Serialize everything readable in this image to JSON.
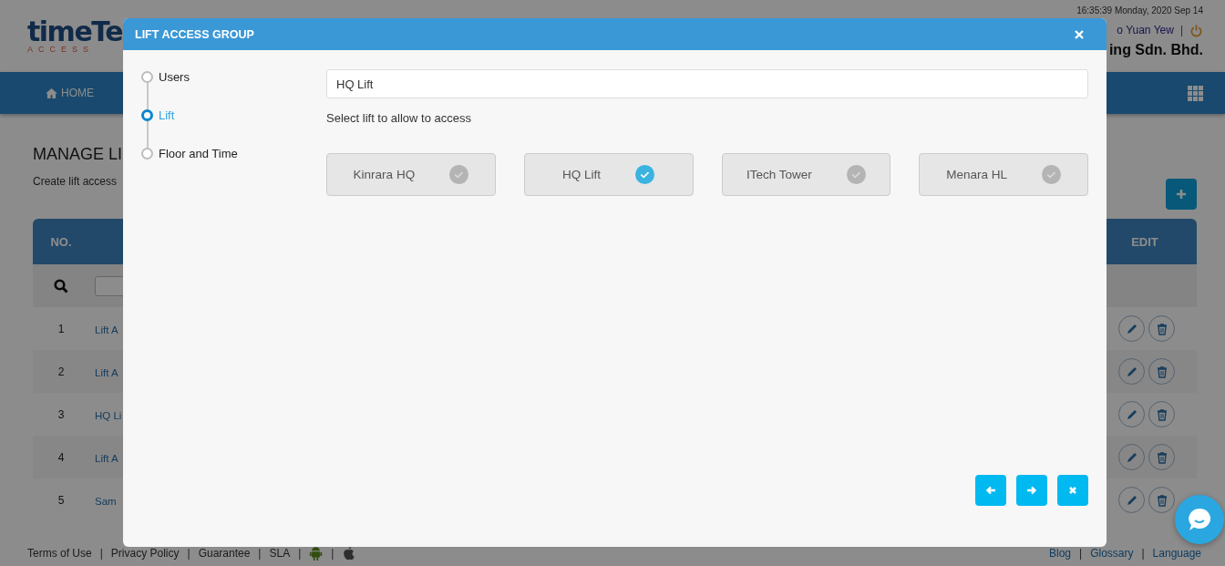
{
  "header": {
    "logo": {
      "text": "timeTe",
      "subtext": "ACCESS"
    },
    "datetime": "16:35:39 Monday, 2020 Sep 14",
    "user": "o Yuan Yew",
    "separator": "|",
    "company": "ing Sdn. Bhd."
  },
  "nav": {
    "items": [
      {
        "label": "HOME"
      }
    ]
  },
  "page": {
    "title": "MANAGE LI",
    "subtitle": "Create lift access"
  },
  "table": {
    "columns": [
      "NO.",
      "EDIT"
    ],
    "rows": [
      {
        "no": "1",
        "name": "Lift A"
      },
      {
        "no": "2",
        "name": "Lift A"
      },
      {
        "no": "3",
        "name": "HQ Li"
      },
      {
        "no": "4",
        "name": "Lift A"
      },
      {
        "no": "5",
        "name": "Sam"
      }
    ]
  },
  "footer": {
    "left_links": [
      "Terms of Use",
      "Privacy Policy",
      "Guarantee",
      "SLA"
    ],
    "separator": "|",
    "right_links": [
      "Blog",
      "Glossary",
      "Language"
    ]
  },
  "modal": {
    "title": "LIFT ACCESS GROUP",
    "steps": [
      {
        "label": "Users",
        "selected": false
      },
      {
        "label": "Lift",
        "selected": true
      },
      {
        "label": "Floor and Time",
        "selected": false
      }
    ],
    "name_field": {
      "value": "HQ Lift"
    },
    "hint": "Select lift to allow to access",
    "lifts": [
      {
        "name": "Kinrara HQ",
        "checked": false
      },
      {
        "name": "HQ Lift",
        "checked": true
      },
      {
        "name": "ITech Tower",
        "checked": false
      },
      {
        "name": "Menara HL",
        "checked": false
      }
    ],
    "buttons": [
      {
        "kind": "back"
      },
      {
        "kind": "next"
      },
      {
        "kind": "cancel"
      }
    ]
  }
}
